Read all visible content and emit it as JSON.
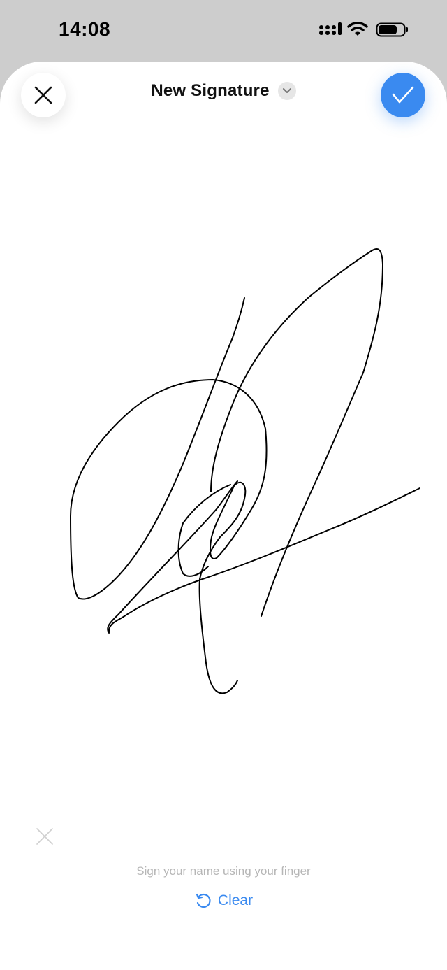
{
  "status_bar": {
    "time": "14:08"
  },
  "header": {
    "title": "New Signature",
    "close_icon": "close-icon",
    "chevron_icon": "chevron-down-icon",
    "confirm_icon": "checkmark-icon"
  },
  "signature": {
    "instruction": "Sign your name using your finger",
    "clear_label": "Clear"
  },
  "colors": {
    "accent": "#3a8af0",
    "status_bar_bg": "#cdcdcd",
    "sheet_bg": "#ffffff",
    "instruction_text": "#b6b6b6"
  }
}
